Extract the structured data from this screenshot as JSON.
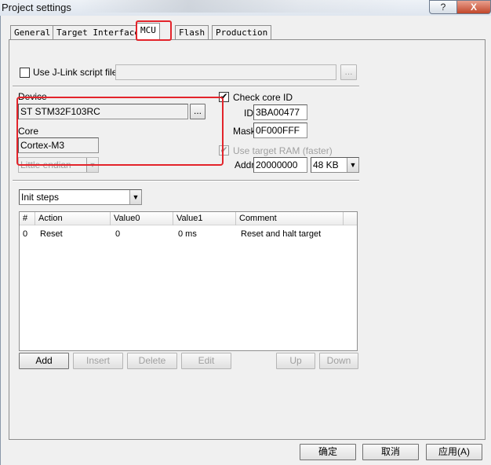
{
  "window": {
    "title": "Project settings",
    "help_glyph": "?",
    "close_glyph": "X"
  },
  "tabs": [
    {
      "label": "General"
    },
    {
      "label": "Target Interface"
    },
    {
      "label": "MCU"
    },
    {
      "label": "Flash"
    },
    {
      "label": "Production"
    }
  ],
  "active_tab": "MCU",
  "script": {
    "checkbox_label": "Use J-Link script file",
    "checked": false,
    "path": "",
    "browse_label": "..."
  },
  "device": {
    "label": "Device",
    "value": "ST STM32F103RC",
    "browse_label": "..."
  },
  "core": {
    "label": "Core",
    "value": "Cortex-M3"
  },
  "endian": {
    "value": "Little endian"
  },
  "core_id": {
    "checkbox_label": "Check core ID",
    "checked": true,
    "id_label": "ID",
    "id_value": "3BA00477",
    "mask_label": "Mask",
    "mask_value": "0F000FFF"
  },
  "target_ram": {
    "checkbox_label": "Use target RAM (faster)",
    "checked": true,
    "addr_label": "Addr",
    "addr_value": "20000000",
    "size_value": "48 KB"
  },
  "steps": {
    "select_value": "Init steps",
    "columns": [
      "#",
      "Action",
      "Value0",
      "Value1",
      "Comment"
    ],
    "rows": [
      {
        "num": "0",
        "action": "Reset",
        "value0": "0",
        "value1": "0 ms",
        "comment": "Reset and halt target"
      }
    ]
  },
  "step_buttons": {
    "add": "Add",
    "insert": "Insert",
    "delete": "Delete",
    "edit": "Edit",
    "up": "Up",
    "down": "Down"
  },
  "footer": {
    "ok": "确定",
    "cancel": "取消",
    "apply": "应用(A)"
  },
  "colors": {
    "highlight": "#e3242b",
    "dialog_bg": "#f0f0f0"
  }
}
